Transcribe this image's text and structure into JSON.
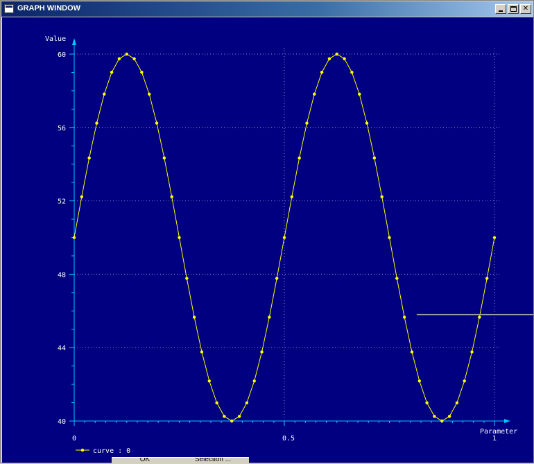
{
  "window": {
    "title": "GRAPH WINDOW",
    "minimize_label": "",
    "maximize_label": "",
    "close_label": "✕"
  },
  "colors": {
    "plot_background": "#000080",
    "axis": "#00c8ff",
    "grid": "#8c8cd2",
    "curve": "#ffff00",
    "text": "#ffffff",
    "marker_line": "#a0a0a0"
  },
  "legend": {
    "label": "curve : 0"
  },
  "bottom_buttons": {
    "ok_label": "OK",
    "selection_label": "Selection ..."
  },
  "chart_data": {
    "type": "line",
    "xlabel": "Parameter",
    "ylabel": "Value",
    "xlim": [
      0,
      1
    ],
    "ylim": [
      40,
      60
    ],
    "x_ticks": [
      0,
      0.5,
      1
    ],
    "x_tick_labels": [
      "0",
      "0.5",
      "1"
    ],
    "y_ticks": [
      40,
      44,
      48,
      52,
      56,
      60
    ],
    "y_tick_labels": [
      "40",
      "44",
      "48",
      "52",
      "56",
      "60"
    ],
    "grid": true,
    "legend_position": "bottom-left",
    "reference_line_y": 45.8,
    "reference_line_x_start": 0.815,
    "series": [
      {
        "name": "curve : 0",
        "x": [
          0,
          0.01786,
          0.03571,
          0.05357,
          0.07143,
          0.08929,
          0.10714,
          0.125,
          0.14286,
          0.16071,
          0.17857,
          0.19643,
          0.21429,
          0.23214,
          0.25,
          0.26786,
          0.28571,
          0.30357,
          0.32143,
          0.33929,
          0.35714,
          0.375,
          0.39286,
          0.41071,
          0.42857,
          0.44643,
          0.46429,
          0.48214,
          0.5,
          0.51786,
          0.53571,
          0.55357,
          0.57143,
          0.58929,
          0.60714,
          0.625,
          0.64286,
          0.66071,
          0.67857,
          0.69643,
          0.71429,
          0.73214,
          0.75,
          0.76786,
          0.78571,
          0.80357,
          0.82143,
          0.83929,
          0.85714,
          0.875,
          0.89286,
          0.91071,
          0.92857,
          0.94643,
          0.96429,
          0.98214,
          1
        ],
        "values": [
          50,
          52.225,
          54.339,
          56.235,
          57.818,
          59.009,
          59.749,
          60,
          59.749,
          59.009,
          57.818,
          56.235,
          54.339,
          52.225,
          50,
          47.775,
          45.661,
          43.765,
          42.182,
          40.991,
          40.251,
          40,
          40.251,
          40.991,
          42.182,
          43.765,
          45.661,
          47.775,
          50,
          52.225,
          54.339,
          56.235,
          57.818,
          59.009,
          59.749,
          60,
          59.749,
          59.009,
          57.818,
          56.235,
          54.339,
          52.225,
          50,
          47.775,
          45.661,
          43.765,
          42.182,
          40.991,
          40.251,
          40,
          40.251,
          40.991,
          42.182,
          43.765,
          45.661,
          47.775,
          50
        ]
      }
    ]
  }
}
